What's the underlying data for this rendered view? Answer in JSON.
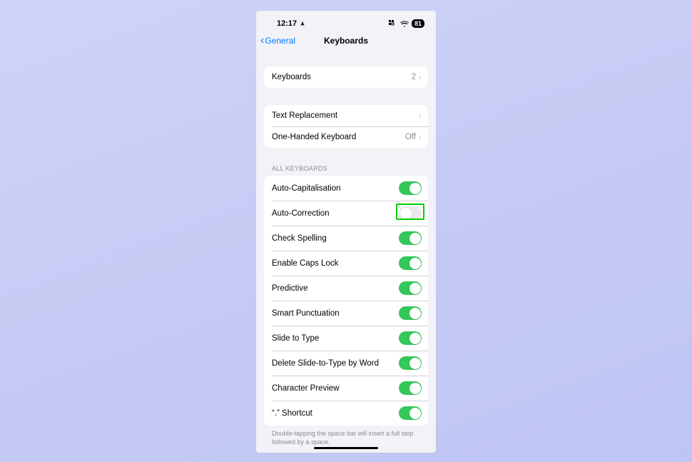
{
  "status": {
    "time": "12:17",
    "battery": "81"
  },
  "nav": {
    "back_label": "General",
    "title": "Keyboards"
  },
  "rows": {
    "keyboards": {
      "label": "Keyboards",
      "value": "2"
    },
    "text_replacement": {
      "label": "Text Replacement"
    },
    "one_handed": {
      "label": "One-Handed Keyboard",
      "value": "Off"
    }
  },
  "section_header": "ALL KEYBOARDS",
  "toggles": [
    {
      "id": "auto-cap",
      "label": "Auto-Capitalisation",
      "on": true,
      "highlight": false
    },
    {
      "id": "auto-correct",
      "label": "Auto-Correction",
      "on": false,
      "highlight": true
    },
    {
      "id": "check-spell",
      "label": "Check Spelling",
      "on": true,
      "highlight": false
    },
    {
      "id": "caps-lock",
      "label": "Enable Caps Lock",
      "on": true,
      "highlight": false
    },
    {
      "id": "predictive",
      "label": "Predictive",
      "on": true,
      "highlight": false
    },
    {
      "id": "smart-punct",
      "label": "Smart Punctuation",
      "on": true,
      "highlight": false
    },
    {
      "id": "slide-type",
      "label": "Slide to Type",
      "on": true,
      "highlight": false
    },
    {
      "id": "del-slide",
      "label": "Delete Slide-to-Type by Word",
      "on": true,
      "highlight": false
    },
    {
      "id": "char-preview",
      "label": "Character Preview",
      "on": true,
      "highlight": false
    },
    {
      "id": "dot-shortcut",
      "label": "“.” Shortcut",
      "on": true,
      "highlight": false
    }
  ],
  "footer": "Double-tapping the space bar will insert a full stop followed by a space."
}
